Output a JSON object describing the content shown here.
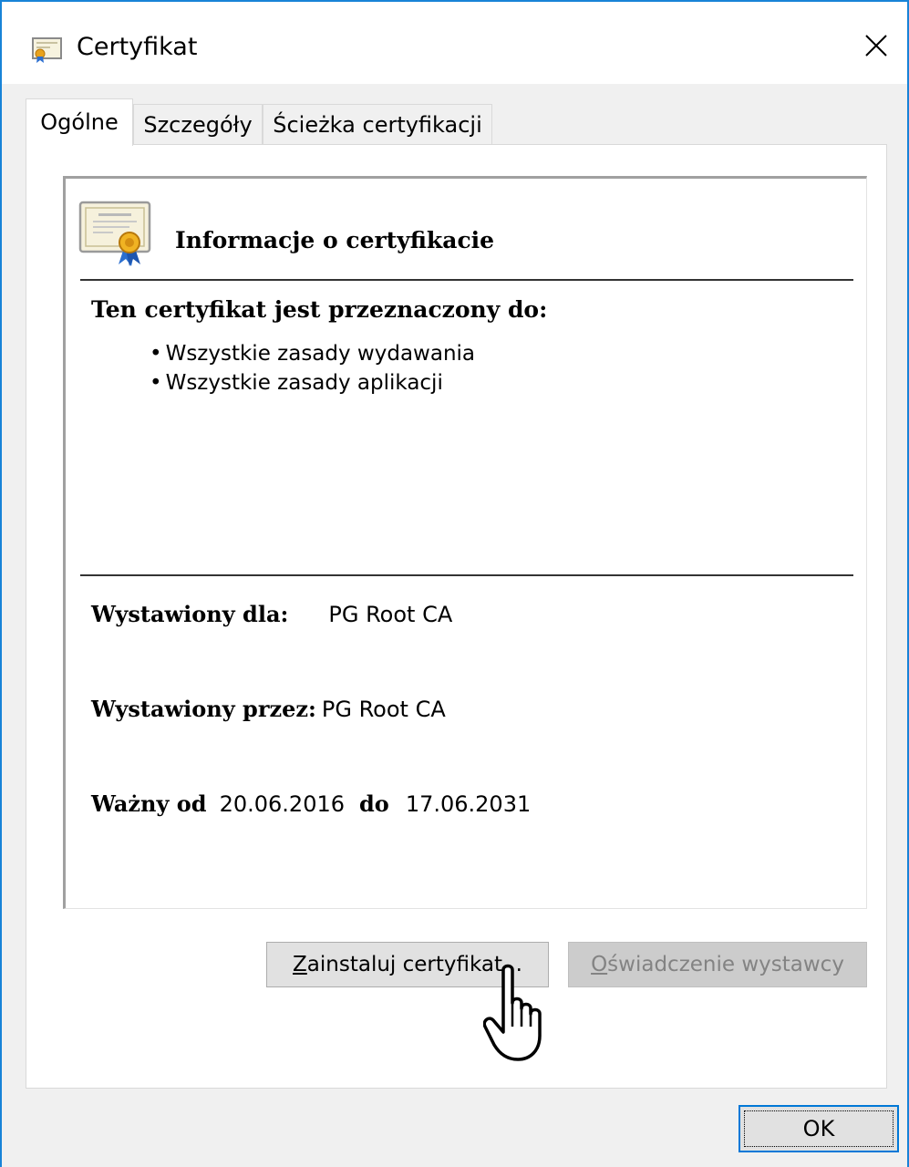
{
  "window": {
    "title": "Certyfikat",
    "accent_color": "#1883d7"
  },
  "tabs": [
    {
      "label": "Ogólne",
      "active": true
    },
    {
      "label": "Szczegóły",
      "active": false
    },
    {
      "label": "Ścieżka certyfikacji",
      "active": false
    }
  ],
  "info": {
    "heading": "Informacje o certyfikacie",
    "purpose_title": "Ten certyfikat jest przeznaczony do:",
    "purposes": [
      "Wszystkie zasady wydawania",
      "Wszystkie zasady aplikacji"
    ],
    "issued_to_label": "Wystawiony dla:",
    "issued_to_value": "PG Root CA",
    "issued_by_label": "Wystawiony przez:",
    "issued_by_value": "PG Root CA",
    "valid_from_label": "Ważny od",
    "valid_from_value": "20.06.2016",
    "valid_to_label": "do",
    "valid_to_value": "17.06.2031"
  },
  "buttons": {
    "install_mnemonic": "Z",
    "install_rest": "ainstaluj certyfikat...",
    "statement_mnemonic": "O",
    "statement_rest": "świadczenie wystawcy",
    "ok_label": "OK"
  },
  "icons": {
    "title": "certificate-icon",
    "close": "close-icon",
    "info": "certificate-icon",
    "cursor": "hand-pointer-icon"
  }
}
